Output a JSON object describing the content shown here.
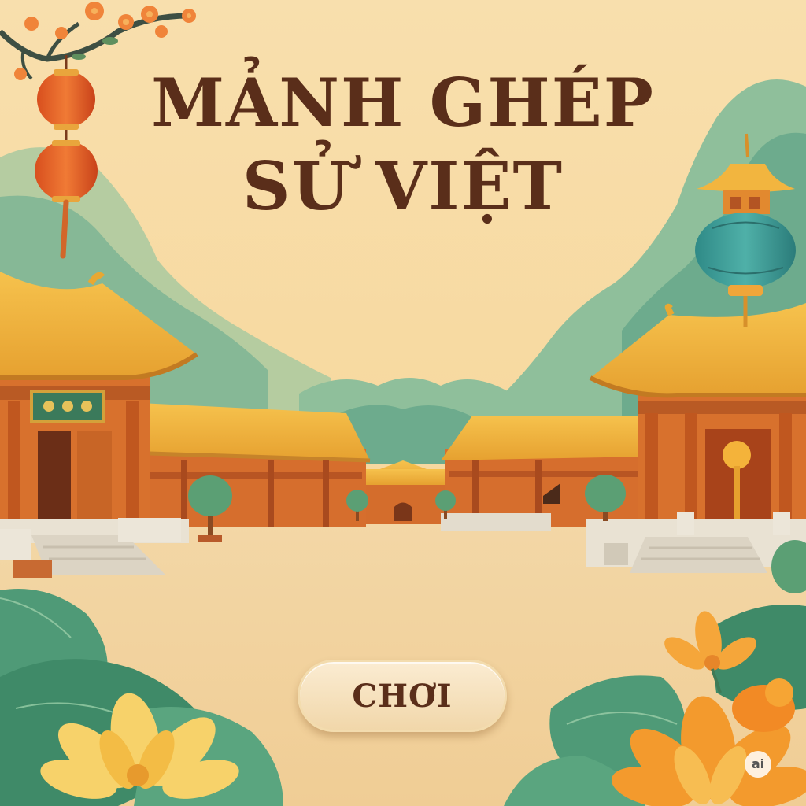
{
  "game": {
    "title_line1": "MẢNH GHÉP",
    "title_line2": "SỬ VIỆT",
    "play_button_label": "CHƠI"
  },
  "watermark": {
    "label": "ai"
  },
  "colors": {
    "sky": "#f6d9a2",
    "title": "#5a2e1a",
    "roof": "#f0b23c",
    "wall": "#d9712e",
    "foliage": "#5fa584",
    "lotus": "#f5a63a"
  },
  "icons": [
    "apricot-blossom-branch-icon",
    "red-lantern-icon",
    "teal-lantern-icon",
    "lotus-flower-icon",
    "lotus-leaf-icon"
  ]
}
